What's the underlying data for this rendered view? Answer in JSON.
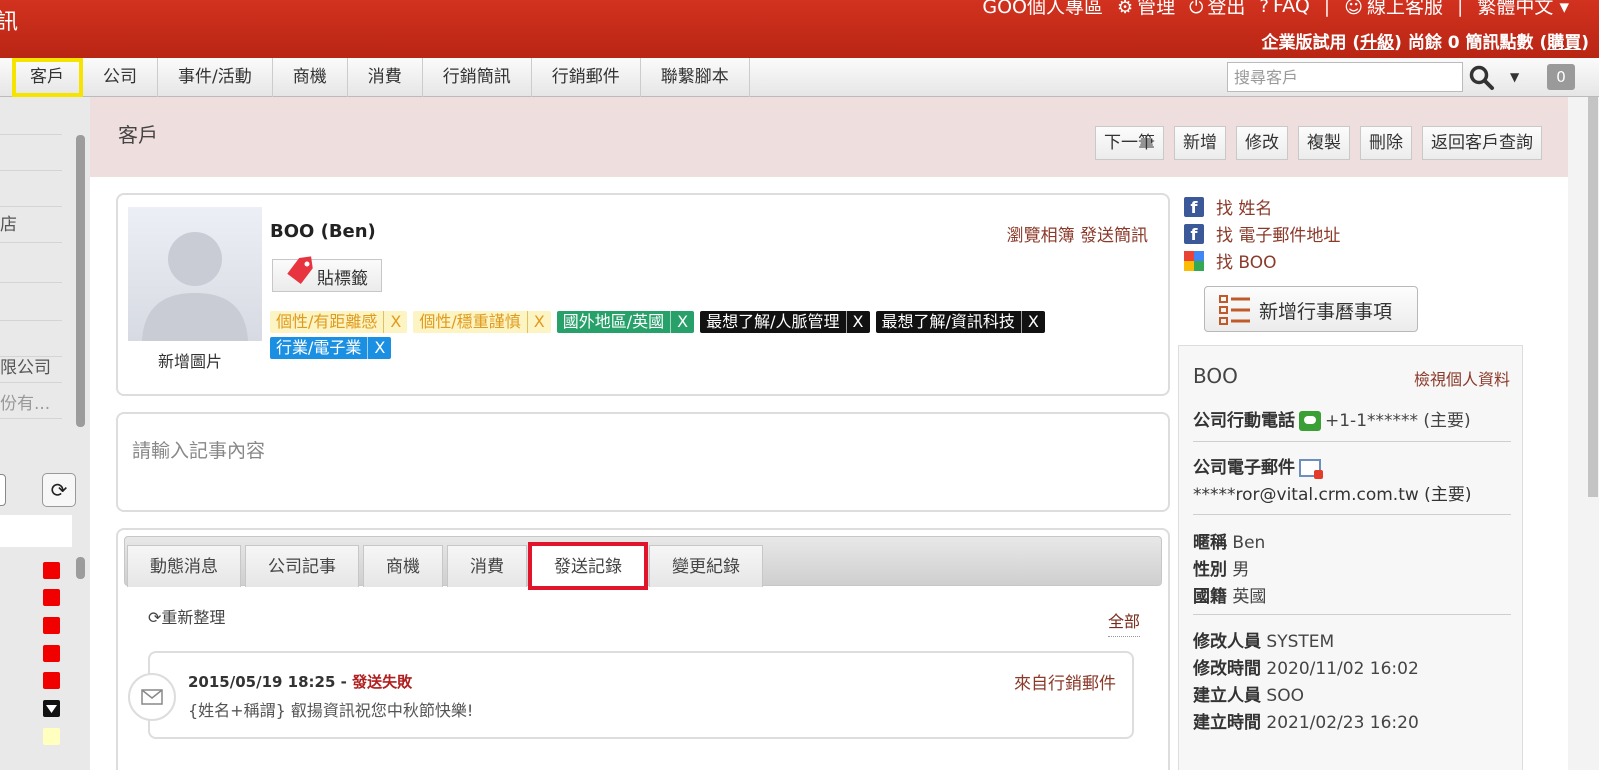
{
  "topbar": {
    "brand": "訊",
    "links": [
      {
        "icon": "",
        "label": "GOO個人專區"
      },
      {
        "icon": "gear-icon",
        "label": "管理"
      },
      {
        "icon": "power-icon",
        "label": "登出"
      },
      {
        "icon": "question-icon",
        "label": "FAQ"
      },
      {
        "icon": "support-icon",
        "label": "線上客服"
      },
      {
        "icon": "chevron-down-icon",
        "label": "繁體中文"
      }
    ],
    "plan_prefix": "企業版試用 (",
    "plan_upgrade": "升級",
    "plan_middle": ") 尚餘 0 簡訊點數 (",
    "plan_buy": "購買",
    "plan_suffix": ")"
  },
  "nav": {
    "tabs": [
      "客戶",
      "公司",
      "事件/活動",
      "商機",
      "消費",
      "行銷簡訊",
      "行銷郵件",
      "聯繫腳本"
    ],
    "active_tab": "客戶",
    "search_placeholder": "搜尋客戶",
    "badge_count": "0"
  },
  "sidebar": {
    "rows": [
      "",
      "",
      "店",
      "",
      "",
      "限公司",
      "份有..."
    ]
  },
  "page": {
    "title": "客戶",
    "actions": [
      "下一筆",
      "新增",
      "修改",
      "複製",
      "刪除",
      "返回客戶查詢"
    ]
  },
  "profile": {
    "add_photo": "新增圖片",
    "name": "BOO (Ben)",
    "tag_button": "貼標籤",
    "links": "瀏覽相簿 發送簡訊",
    "tags": [
      {
        "text": "個性/有距離感",
        "x": "X",
        "color": "#fdf4c3"
      },
      {
        "text": "個性/穩重謹慎",
        "x": "X",
        "color": "#fdf4c3"
      },
      {
        "text": "國外地區/英國",
        "x": "X",
        "color": "#27a06a"
      },
      {
        "text": "最想了解/人脈管理",
        "x": "X",
        "color": "#111111"
      },
      {
        "text": "最想了解/資訊科技",
        "x": "X",
        "color": "#111111"
      },
      {
        "text": "行業/電子業",
        "x": "X",
        "color": "#1b90e3"
      }
    ]
  },
  "note": {
    "placeholder": "請輸入記事內容"
  },
  "activity": {
    "tabs": [
      "動態消息",
      "公司記事",
      "商機",
      "消費",
      "發送記錄",
      "變更紀錄"
    ],
    "selected_tab": "發送記錄",
    "refresh_label": "重新整理",
    "all_label": "全部",
    "entry": {
      "date": "2015/05/19 18:25",
      "status": "發送失敗",
      "source": "來自行銷郵件",
      "message": "{姓名+稱謂} 叡揚資訊祝您中秋節快樂!"
    }
  },
  "find": [
    {
      "icon": "facebook-icon",
      "label": "找 姓名"
    },
    {
      "icon": "facebook-icon",
      "label": "找 電子郵件地址"
    },
    {
      "icon": "google-icon",
      "label": "找 BOO"
    }
  ],
  "add_event_label": "新增行事曆事項",
  "person": {
    "name": "BOO",
    "view_label": "檢視個人資料",
    "mobile_label": "公司行動電話",
    "mobile_value": "+1-1****** (主要)",
    "email_label": "公司電子郵件",
    "email_value": "*****ror@vital.crm.com.tw (主要)",
    "nickname_label": "暱稱",
    "nickname_value": "Ben",
    "gender_label": "性別",
    "gender_value": "男",
    "nationality_label": "國籍",
    "nationality_value": "英國",
    "modifier_label": "修改人員",
    "modifier_value": "SYSTEM",
    "modified_label": "修改時間",
    "modified_value": "2020/11/02 16:02",
    "creator_label": "建立人員",
    "creator_value": "SOO",
    "created_label": "建立時間",
    "created_value": "2021/02/23 16:20"
  }
}
